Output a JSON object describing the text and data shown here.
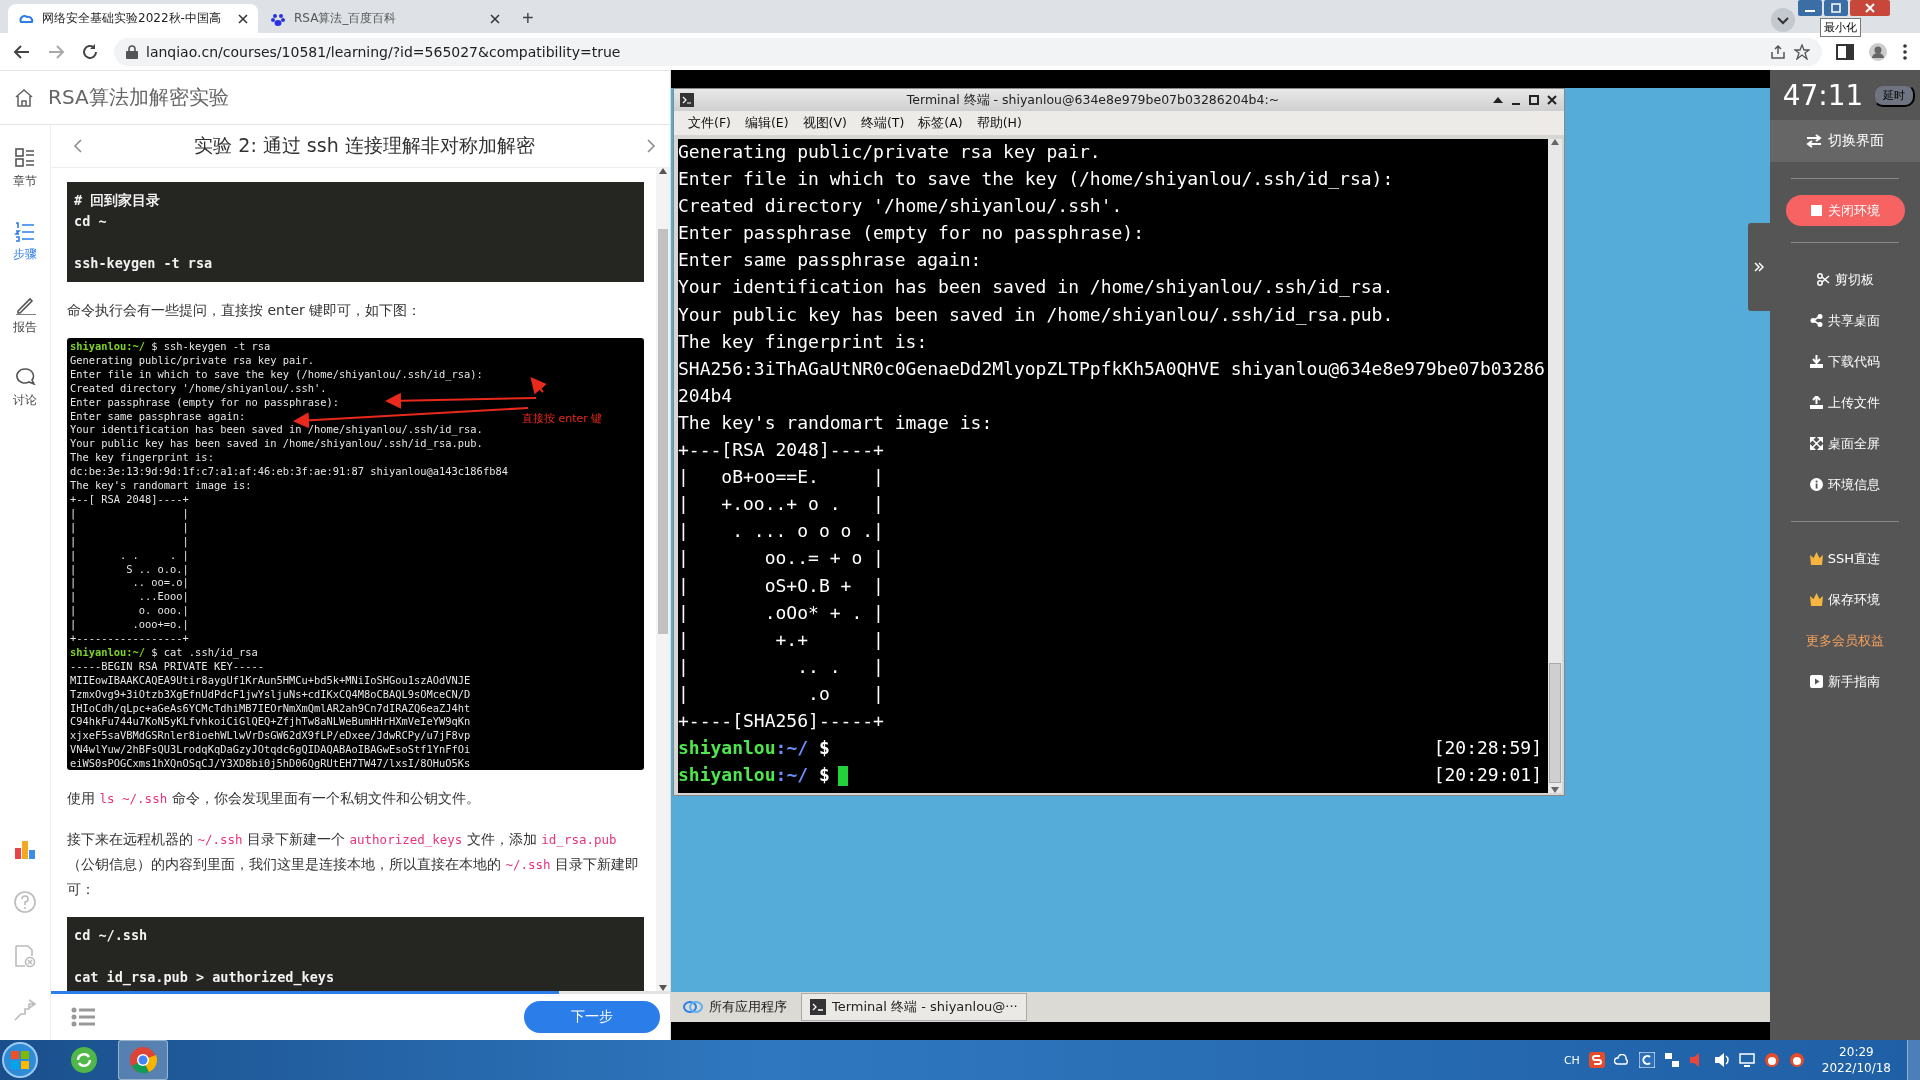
{
  "browser": {
    "tabs": [
      {
        "title": "网络安全基础实验2022秋-中国高",
        "selected": true
      },
      {
        "title": "RSA算法_百度百科",
        "selected": false
      }
    ],
    "new_tab": "+",
    "url": "lanqiao.cn/courses/10581/learning/?id=565027&compatibility=true",
    "tooltip": "最小化"
  },
  "course": {
    "title": "RSA算法加解密实验",
    "step_title": "实验 2: 通过 ssh 连接理解非对称加解密",
    "rail": [
      {
        "label": "章节",
        "kind": "chapters",
        "selected": false
      },
      {
        "label": "步骤",
        "kind": "steps",
        "selected": true
      },
      {
        "label": "报告",
        "kind": "report",
        "selected": false
      },
      {
        "label": "讨论",
        "kind": "discuss",
        "selected": false
      }
    ],
    "blocks": [
      {
        "kind": "code",
        "groups": [
          [
            "# 回到家目录",
            "cd ~"
          ],
          [
            "ssh-keygen -t rsa"
          ]
        ]
      },
      {
        "kind": "paragraph",
        "parts": [
          {
            "text": "命令执行会有一些提问，直接按 enter 键即可，如下图：",
            "code": false
          }
        ]
      },
      {
        "kind": "screenshot",
        "note": "直接按 enter 键",
        "lines": [
          {
            "kind": "prompt",
            "user": "shiyanlou:~/",
            "command": " $ ssh-keygen -t rsa"
          },
          {
            "kind": "output",
            "text": "Generating public/private rsa key pair."
          },
          {
            "kind": "output",
            "text": "Enter file in which to save the key (/home/shiyanlou/.ssh/id_rsa):"
          },
          {
            "kind": "output",
            "text": "Created directory '/home/shiyanlou/.ssh'."
          },
          {
            "kind": "output",
            "text": "Enter passphrase (empty for no passphrase):"
          },
          {
            "kind": "output",
            "text": "Enter same passphrase again:"
          },
          {
            "kind": "output",
            "text": "Your identification has been saved in /home/shiyanlou/.ssh/id_rsa."
          },
          {
            "kind": "output",
            "text": "Your public key has been saved in /home/shiyanlou/.ssh/id_rsa.pub."
          },
          {
            "kind": "output",
            "text": "The key fingerprint is:"
          },
          {
            "kind": "output",
            "text": "dc:be:3e:13:9d:9d:1f:c7:a1:af:46:eb:3f:ae:91:87 shiyanlou@a143c186fb84"
          },
          {
            "kind": "output",
            "text": "The key's randomart image is:"
          },
          {
            "kind": "output",
            "text": "+--[ RSA 2048]----+"
          },
          {
            "kind": "output",
            "text": "|                 |"
          },
          {
            "kind": "output",
            "text": "|                 |"
          },
          {
            "kind": "output",
            "text": "|                 |"
          },
          {
            "kind": "output",
            "text": "|       . .     . |"
          },
          {
            "kind": "output",
            "text": "|        S .. o.o.|"
          },
          {
            "kind": "output",
            "text": "|         .. oo=.o|"
          },
          {
            "kind": "output",
            "text": "|          ...Eooo|"
          },
          {
            "kind": "output",
            "text": "|          o. ooo.|"
          },
          {
            "kind": "output",
            "text": "|         .ooo+=o.|"
          },
          {
            "kind": "output",
            "text": "+-----------------+"
          },
          {
            "kind": "prompt",
            "user": "shiyanlou:~/",
            "command": " $ cat .ssh/id_rsa"
          },
          {
            "kind": "output",
            "text": "-----BEGIN RSA PRIVATE KEY-----"
          },
          {
            "kind": "output",
            "text": "MIIEowIBAAKCAQEA9Utir8aygUf1KrAun5HMCu+bd5k+MNiIoSHGou1szAOdVNJE"
          },
          {
            "kind": "output",
            "text": "TzmxOvg9+3iOtzb3XgEfnUdPdcF1jwYsljuNs+cdIKxCQ4M8oCBAQL9sOMceCN/D"
          },
          {
            "kind": "output",
            "text": "IHIoCdh/qLpc+aGeAs6YCMcTdhiMB7IEOrNmXmQmlAR2ah9Cn7dIRAZQ6eaZJ4ht"
          },
          {
            "kind": "output",
            "text": "C94hkFu744u7KoN5yKLfvhkoiCiGlQEQ+ZfjhTw8aNLWeBumHHrHXmVeIeYW9qKn"
          },
          {
            "kind": "output",
            "text": "xjxeF5saVBMdGSRnler8ioehWLlwVrDsGW62dX9fLP/eDxee/JdwRCPy/u7jF8vp"
          },
          {
            "kind": "output",
            "text": "VN4wlYuw/2hBFsQU3LrodqKqDaGzyJOtqdc6gQIDAQABAoIBAGwEsoStf1YnFfOi"
          },
          {
            "kind": "output",
            "text": "eiWS0sPOGCxms1hXQnOSqCJ/Y3XD8bi0j5hD06QgRUtEH7TW47/lxsI/8OHuO5Ks"
          }
        ]
      },
      {
        "kind": "paragraph",
        "parts": [
          {
            "text": "使用 ",
            "code": false
          },
          {
            "text": "ls ~/.ssh",
            "code": true
          },
          {
            "text": " 命令，你会发现里面有一个私钥文件和公钥文件。",
            "code": false
          }
        ]
      },
      {
        "kind": "paragraph",
        "parts": [
          {
            "text": "接下来在远程机器的 ",
            "code": false
          },
          {
            "text": "~/.ssh",
            "code": true
          },
          {
            "text": " 目录下新建一个 ",
            "code": false
          },
          {
            "text": "authorized_keys",
            "code": true
          },
          {
            "text": " 文件，添加 ",
            "code": false
          },
          {
            "text": "id_rsa.pub",
            "code": true
          },
          {
            "text": "（公钥信息）的内容到里面，我们这里是连接本地，所以直接在本地的 ",
            "code": false
          },
          {
            "text": "~/.ssh",
            "code": true
          },
          {
            "text": " 目录下新建即可：",
            "code": false
          }
        ]
      },
      {
        "kind": "code",
        "groups": [
          [
            "cd ~/.ssh"
          ],
          [
            "cat id_rsa.pub > authorized_keys"
          ]
        ]
      }
    ],
    "progress": {
      "level": 0.82
    },
    "next_button": "下一步"
  },
  "terminal": {
    "title": "Terminal 终端 - shiyanlou@634e8e979be07b03286204b4:~",
    "menu": [
      "文件(F)",
      "编辑(E)",
      "视图(V)",
      "终端(T)",
      "标签(A)",
      "帮助(H)"
    ],
    "lines": [
      "Generating public/private rsa key pair.",
      "Enter file in which to save the key (/home/shiyanlou/.ssh/id_rsa):",
      "Created directory '/home/shiyanlou/.ssh'.",
      "Enter passphrase (empty for no passphrase):",
      "Enter same passphrase again:",
      "Your identification has been saved in /home/shiyanlou/.ssh/id_rsa.",
      "Your public key has been saved in /home/shiyanlou/.ssh/id_rsa.pub.",
      "The key fingerprint is:",
      "SHA256:3iThAGaUtNR0c0GenaeDd2MlyopZLTPpfkKh5A0QHVE shiyanlou@634e8e979be07b03286",
      "204b4",
      "The key's randomart image is:",
      "+---[RSA 2048]----+",
      "|   oB+oo==E.     |",
      "|   +.oo..+ o .   |",
      "|    . ... o o o .|",
      "|       oo..= + o |",
      "|       oS+O.B +  |",
      "|       .oOo* + . |",
      "|        +.+      |",
      "|          .. .   |",
      "|           .o    |",
      "+----[SHA256]-----+"
    ],
    "prompts": [
      {
        "user": "shiyanlou",
        "path": ":~/",
        "sign": "$",
        "time": "[20:28:59]",
        "cursor": false
      },
      {
        "user": "shiyanlou",
        "path": ":~/",
        "sign": "$",
        "time": "[20:29:01]",
        "cursor": true
      }
    ]
  },
  "remote_taskbar": {
    "apps_menu": "所有应用程序",
    "tasks": [
      {
        "label": "Terminal 终端 - shiyanlou@···",
        "selected": true
      }
    ]
  },
  "env_panel": {
    "timer": "47:11",
    "extend": "延时",
    "switch": "切换界面",
    "close": "关闭环境",
    "items": [
      {
        "label": "剪切板",
        "kind": "scissors"
      },
      {
        "label": "共享桌面",
        "kind": "share"
      },
      {
        "label": "下载代码",
        "kind": "download"
      },
      {
        "label": "上传文件",
        "kind": "upload"
      },
      {
        "label": "桌面全屏",
        "kind": "fullscreen"
      },
      {
        "label": "环境信息",
        "kind": "info"
      },
      {
        "label": "SSH直连",
        "kind": "crown"
      },
      {
        "label": "保存环境",
        "kind": "crown"
      },
      {
        "label": "更多会员权益",
        "kind": "promo"
      },
      {
        "label": "新手指南",
        "kind": "video"
      }
    ]
  },
  "os_taskbar": {
    "input_lang": "CH",
    "time": "20:29",
    "date": "2022/10/18"
  }
}
